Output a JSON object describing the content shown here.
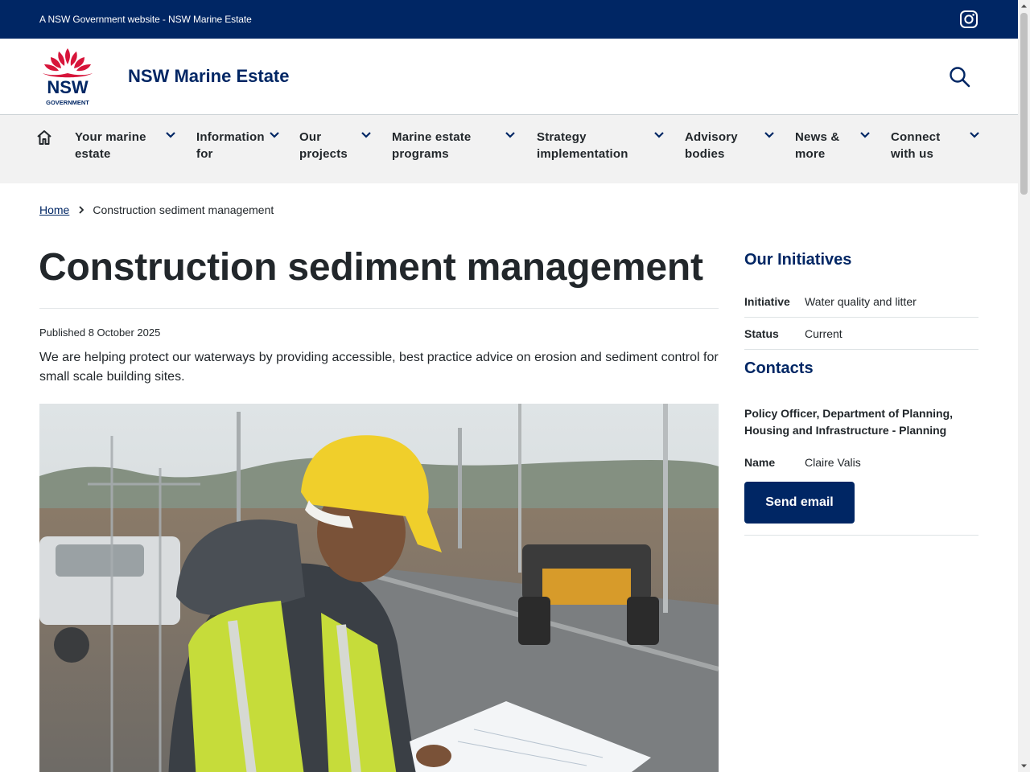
{
  "masthead": {
    "text": "A NSW Government website - NSW Marine Estate"
  },
  "header": {
    "site_title": "NSW Marine Estate",
    "logo_text": "NSW",
    "logo_subtext": "GOVERNMENT"
  },
  "nav": {
    "items": [
      {
        "line1": "Your marine",
        "line2": "estate"
      },
      {
        "line1": "Information",
        "line2": "for"
      },
      {
        "line1": "Our",
        "line2": "projects"
      },
      {
        "line1": "Marine estate",
        "line2": "programs"
      },
      {
        "line1": "Strategy",
        "line2": "implementation"
      },
      {
        "line1": "Advisory",
        "line2": "bodies"
      },
      {
        "line1": "News &",
        "line2": "more"
      },
      {
        "line1": "Connect",
        "line2": "with us"
      }
    ]
  },
  "breadcrumb": {
    "home": "Home",
    "current": "Construction sediment management"
  },
  "main": {
    "title": "Construction sediment management",
    "published": "Published 8 October 2025",
    "intro": "We are helping protect our waterways by providing accessible, best practice advice on erosion and sediment control for small scale building sites."
  },
  "sidebar": {
    "initiatives_title": "Our Initiatives",
    "initiative_label": "Initiative",
    "initiative_value": "Water quality and litter",
    "status_label": "Status",
    "status_value": "Current",
    "contacts_title": "Contacts",
    "contact_role": "Policy Officer, Department of Planning, Housing and Infrastructure - Planning",
    "name_label": "Name",
    "name_value": "Claire Valis",
    "send_email": "Send email"
  },
  "colors": {
    "navy": "#002664",
    "red": "#d7153a",
    "nav_bg": "#f2f2f2"
  }
}
